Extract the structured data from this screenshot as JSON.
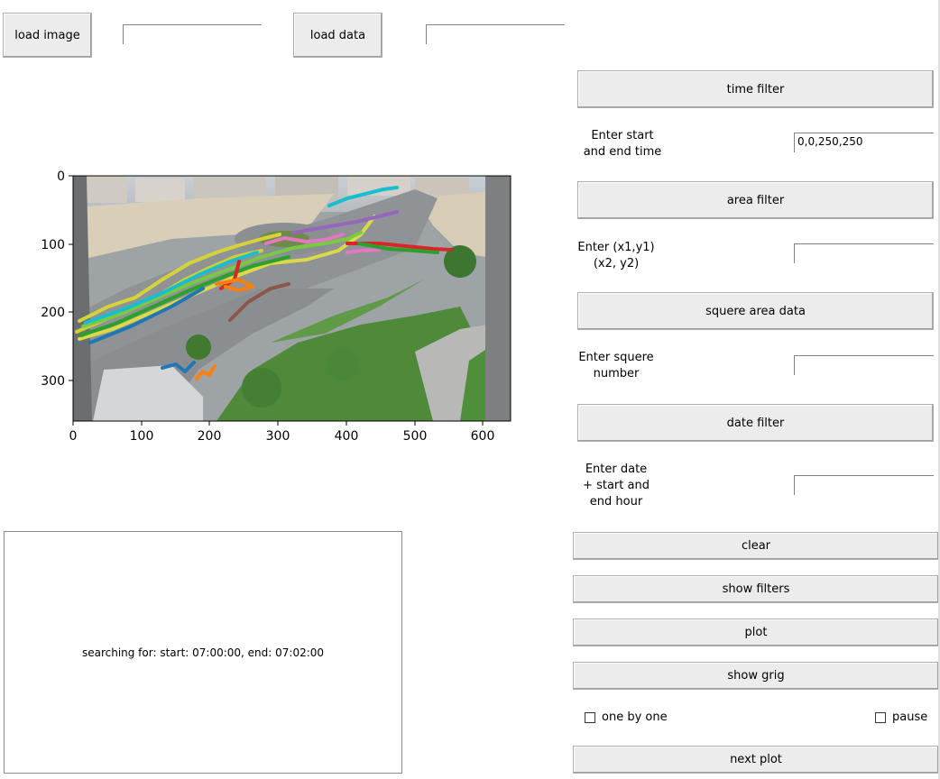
{
  "toolbar": {
    "load_image_label": "load image",
    "load_data_label": "load data",
    "image_path_value": "",
    "data_path_value": ""
  },
  "filters": {
    "time_filter_label": "time filter",
    "time_prompt_line1": "Enter start",
    "time_prompt_line2": "and end time",
    "time_value": "0,0,250,250",
    "area_filter_label": "area filter",
    "area_prompt_line1": "Enter (x1,y1)",
    "area_prompt_line2": "(x2, y2)",
    "area_value": "",
    "square_area_label": "squere area data",
    "square_prompt_line1": "Enter squere",
    "square_prompt_line2": "number",
    "square_value": "",
    "date_filter_label": "date filter",
    "date_prompt_line1": "Enter date",
    "date_prompt_line2": "+ start and",
    "date_prompt_line3": "end hour",
    "date_value": ""
  },
  "actions": {
    "clear_label": "clear",
    "show_filters_label": "show filters",
    "plot_label": "plot",
    "show_grid_label": "show grig",
    "one_by_one_label": "one by one",
    "pause_label": "pause",
    "next_plot_label": "next plot",
    "one_by_one_checked": false,
    "pause_checked": false
  },
  "status": {
    "message": "searching for: start: 07:00:00, end: 07:02:00"
  },
  "plot": {
    "x_ticks": [
      "0",
      "100",
      "200",
      "300",
      "400",
      "500",
      "600"
    ],
    "y_ticks": [
      "0",
      "100",
      "200",
      "300"
    ],
    "xlim": [
      0,
      640
    ],
    "ylim": [
      0,
      360
    ],
    "background": "street camera frame with roundabout, roads, grass and buildings",
    "track_colors": [
      "#d4d43a",
      "#2ca02c",
      "#17becf",
      "#1f77b4",
      "#9467bd",
      "#e377c2",
      "#d62728",
      "#ff7f0e",
      "#8c564b",
      "#bcbd22"
    ]
  }
}
